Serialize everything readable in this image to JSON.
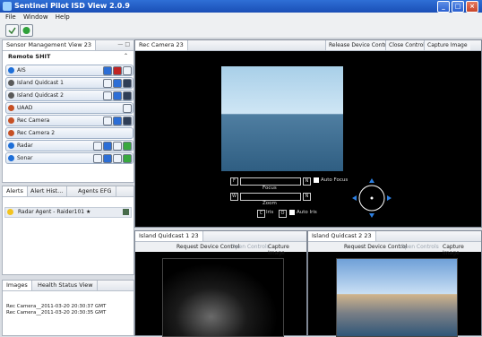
{
  "window": {
    "title": "Sentinel Pilot ISD View 2.0.9"
  },
  "menu": {
    "file": "File",
    "window": "Window",
    "help": "Help"
  },
  "left_panel": {
    "tab_label": "Sensor Management View",
    "tab_id": "23",
    "section_title": "Remote SHIT",
    "sensors": [
      {
        "name": "AIS",
        "color": "#1e6fd8"
      },
      {
        "name": "Island Quidcast 1",
        "color": "#5a5a5a"
      },
      {
        "name": "Island Quidcast 2",
        "color": "#5a5a5a"
      },
      {
        "name": "UAAD",
        "color": "#c65024"
      },
      {
        "name": "Rec Camera",
        "color": "#c65024"
      },
      {
        "name": "Rec Camera 2",
        "color": "#c65024"
      },
      {
        "name": "Radar",
        "color": "#1e6fd8"
      },
      {
        "name": "Sonar",
        "color": "#1e6fd8"
      }
    ]
  },
  "alerts_panel": {
    "tabs": [
      "Alerts",
      "Alert Hist...",
      "Agents EFG"
    ],
    "alert_text": "Radar Agent - Raider101 ★"
  },
  "images_panel": {
    "tabs": [
      "Images",
      "Health Status View"
    ],
    "items": [
      "Rec Camera__2011-03-20 20:30:37 GMT",
      "Rec Camera__2011-03-20 20:30:35 GMT"
    ]
  },
  "main_camera": {
    "tab_label": "Rec Camera",
    "tab_id": "23",
    "buttons": [
      "Release Device Control",
      "Close Controls",
      "Capture Image"
    ],
    "controls": {
      "focus": "Focus",
      "zoom": "Zoom",
      "auto_focus": "Auto Focus",
      "auto_iris": "Auto Iris",
      "iris": "Iris"
    }
  },
  "cam1": {
    "tab_label": "Island Quidcast 1",
    "tab_id": "23",
    "buttons": [
      "Request Device Control",
      "Open Controls",
      "Capture Image"
    ]
  },
  "cam2": {
    "tab_label": "Island Quidcast 2",
    "tab_id": "23",
    "buttons": [
      "Request Device Control",
      "Open Controls",
      "Capture Image"
    ]
  }
}
